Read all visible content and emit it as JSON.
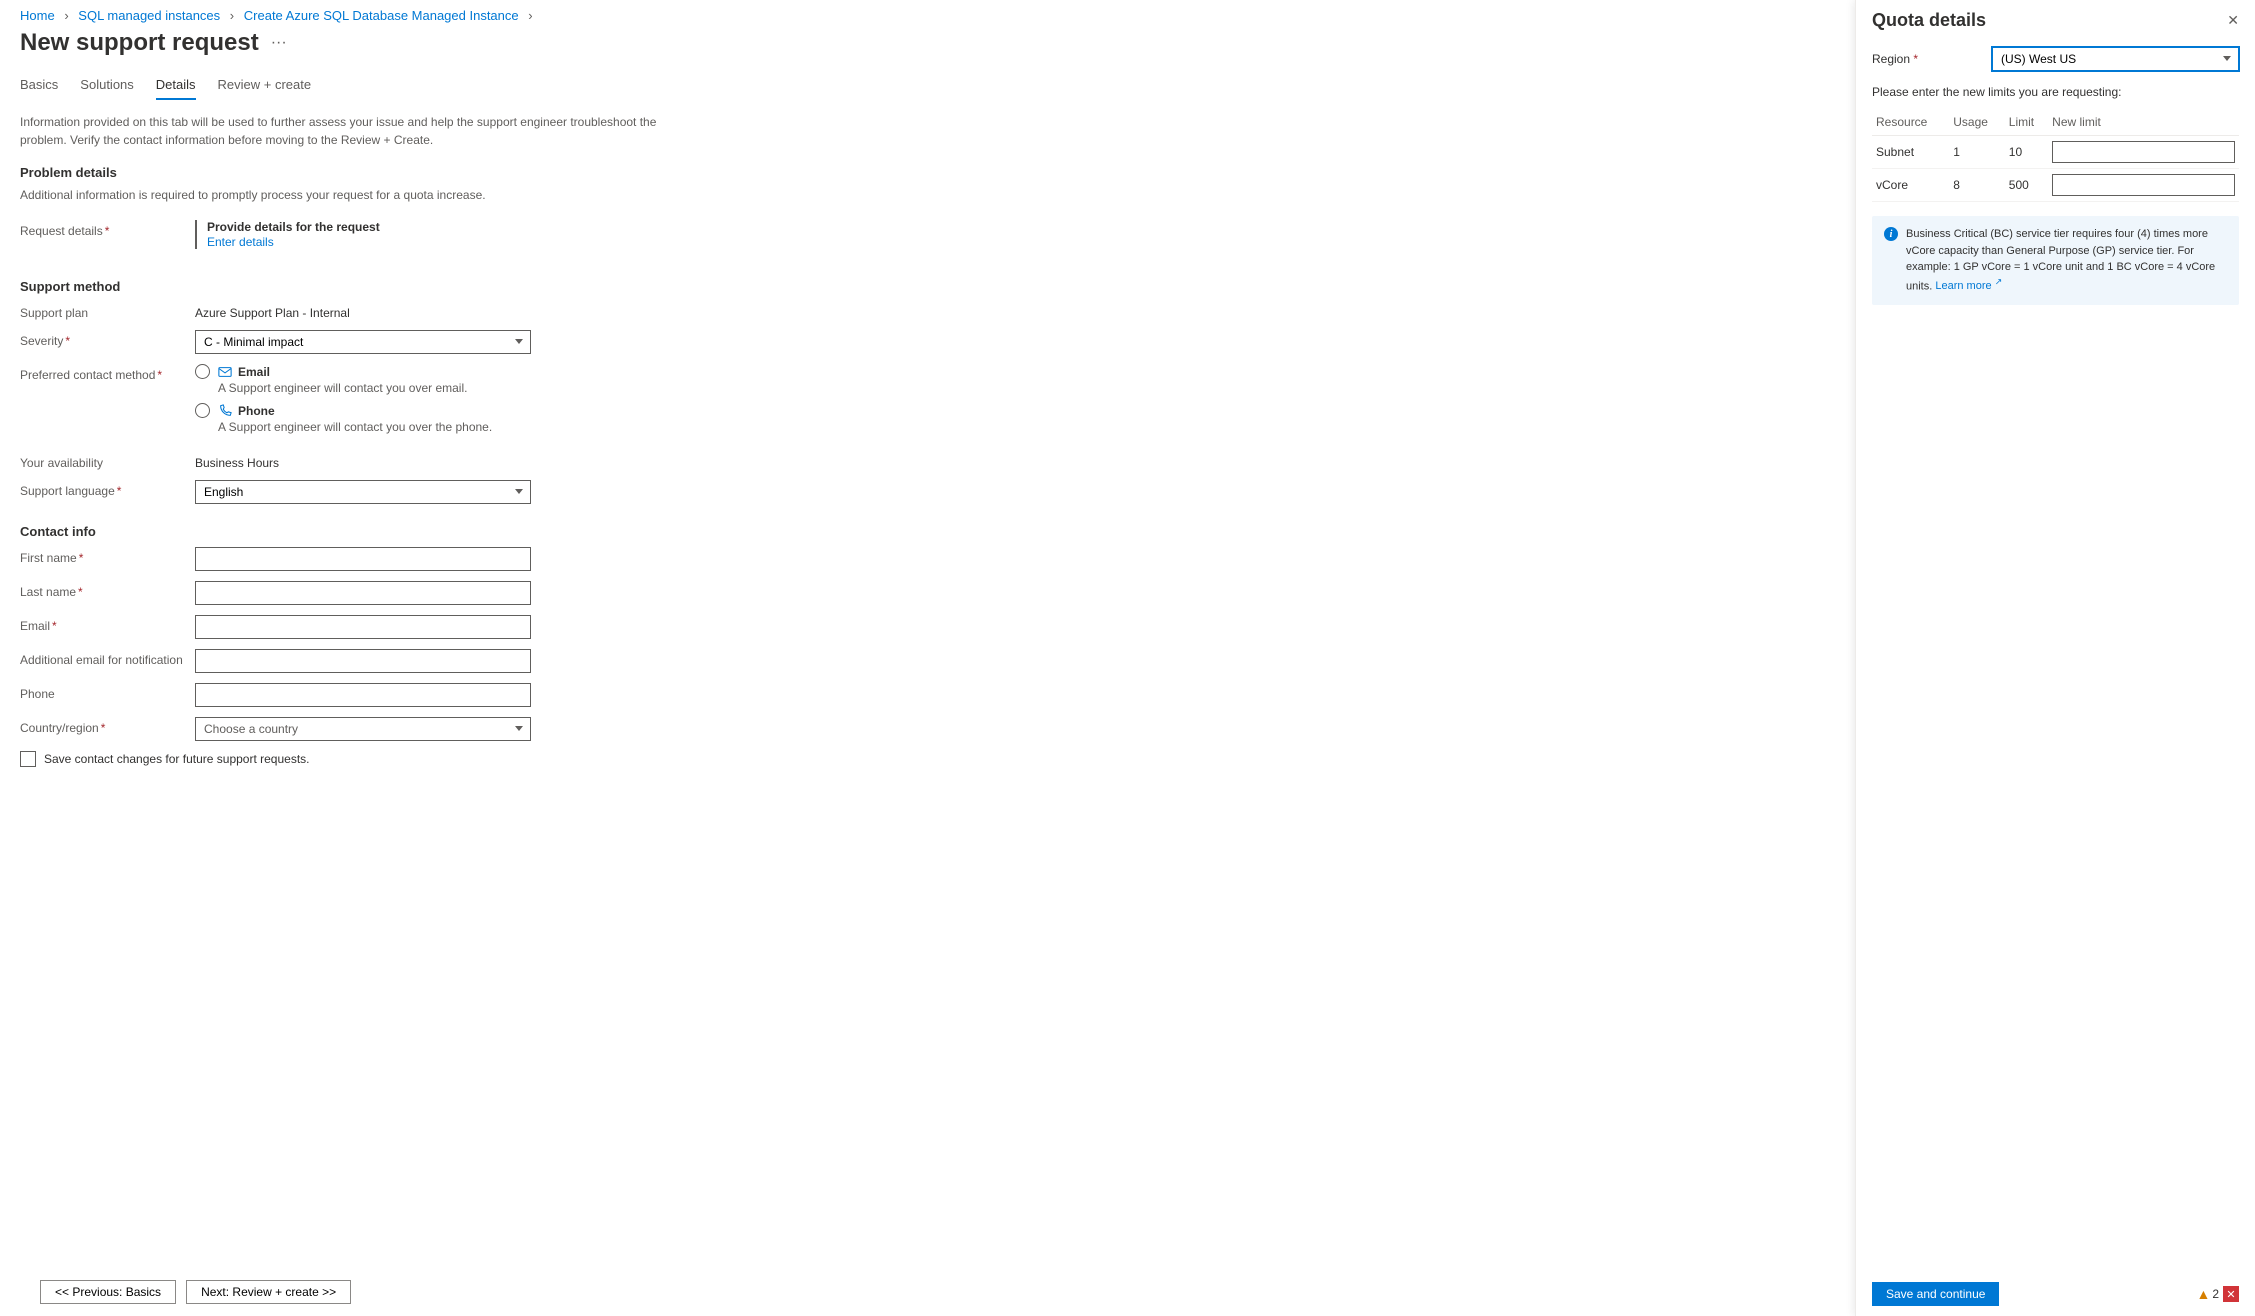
{
  "breadcrumb": [
    {
      "label": "Home"
    },
    {
      "label": "SQL managed instances"
    },
    {
      "label": "Create Azure SQL Database Managed Instance"
    }
  ],
  "page_title": "New support request",
  "tabs": [
    {
      "label": "Basics"
    },
    {
      "label": "Solutions"
    },
    {
      "label": "Details"
    },
    {
      "label": "Review + create"
    }
  ],
  "active_tab": 2,
  "info_text": "Information provided on this tab will be used to further assess your issue and help the support engineer troubleshoot the problem. Verify the contact information before moving to the Review + Create.",
  "problem": {
    "heading": "Problem details",
    "sub": "Additional information is required to promptly process your request for a quota increase.",
    "request_details_label": "Request details",
    "provide": "Provide details for the request",
    "enter_link": "Enter details"
  },
  "support": {
    "heading": "Support method",
    "plan_label": "Support plan",
    "plan_value": "Azure Support Plan - Internal",
    "severity_label": "Severity",
    "severity_value": "C - Minimal impact",
    "contact_label": "Preferred contact method",
    "email_label": "Email",
    "email_desc": "A Support engineer will contact you over email.",
    "phone_label": "Phone",
    "phone_desc": "A Support engineer will contact you over the phone.",
    "avail_label": "Your availability",
    "avail_value": "Business Hours",
    "lang_label": "Support language",
    "lang_value": "English"
  },
  "contact": {
    "heading": "Contact info",
    "first_name": "First name",
    "last_name": "Last name",
    "email": "Email",
    "add_email": "Additional email for notification",
    "phone": "Phone",
    "country": "Country/region",
    "country_placeholder": "Choose a country",
    "save_chk": "Save contact changes for future support requests."
  },
  "nav": {
    "prev": "<< Previous: Basics",
    "next": "Next: Review + create >>"
  },
  "panel": {
    "title": "Quota details",
    "region_label": "Region",
    "region_value": "(US) West US",
    "hint": "Please enter the new limits you are requesting:",
    "cols": {
      "resource": "Resource",
      "usage": "Usage",
      "limit": "Limit",
      "newlimit": "New limit"
    },
    "rows": [
      {
        "resource": "Subnet",
        "usage": "1",
        "limit": "10"
      },
      {
        "resource": "vCore",
        "usage": "8",
        "limit": "500"
      }
    ],
    "info": "Business Critical (BC) service tier requires four (4) times more vCore capacity than General Purpose (GP) service tier. For example: 1 GP vCore = 1 vCore unit and 1 BC vCore = 4 vCore units.",
    "learn_more": "Learn more",
    "save_btn": "Save and continue",
    "warn_count": "2"
  }
}
